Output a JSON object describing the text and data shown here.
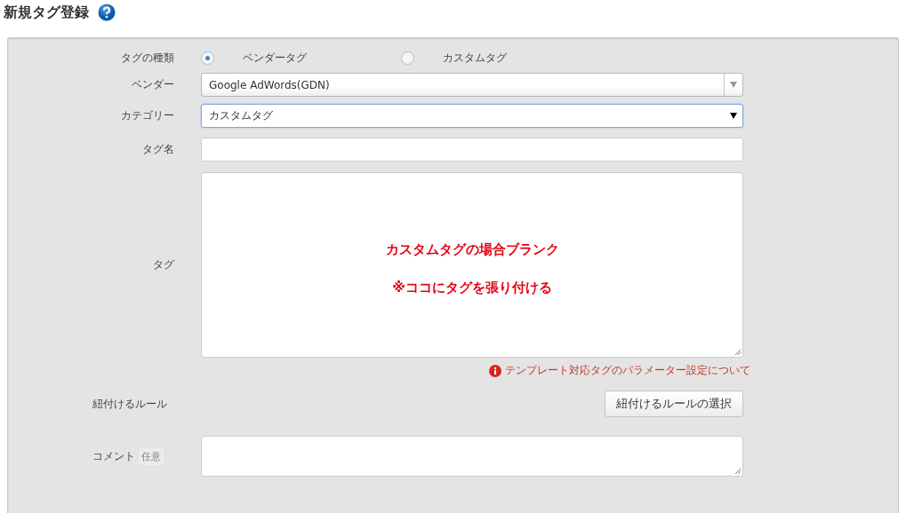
{
  "title": "新規タグ登録",
  "form": {
    "tag_type": {
      "label": "タグの種類",
      "options": [
        {
          "label": "ベンダータグ",
          "selected": true
        },
        {
          "label": "カスタムタグ",
          "selected": false
        }
      ]
    },
    "vendor": {
      "label": "ベンダー",
      "value": "Google AdWords(GDN)",
      "focused": false
    },
    "category": {
      "label": "カテゴリー",
      "value": "カスタムタグ",
      "focused": true
    },
    "tag_name": {
      "label": "タグ名"
    },
    "tag": {
      "label": "タグ",
      "annotations": [
        "カスタムタグの場合ブランク",
        "※ココにタグを張り付ける"
      ]
    },
    "help_link": "テンプレート対応タグのパラメーター設定について",
    "rule": {
      "label": "紐付けるルール",
      "button": "紐付けるルールの選択"
    },
    "comment": {
      "label": "コメント",
      "badge": "任意"
    }
  }
}
